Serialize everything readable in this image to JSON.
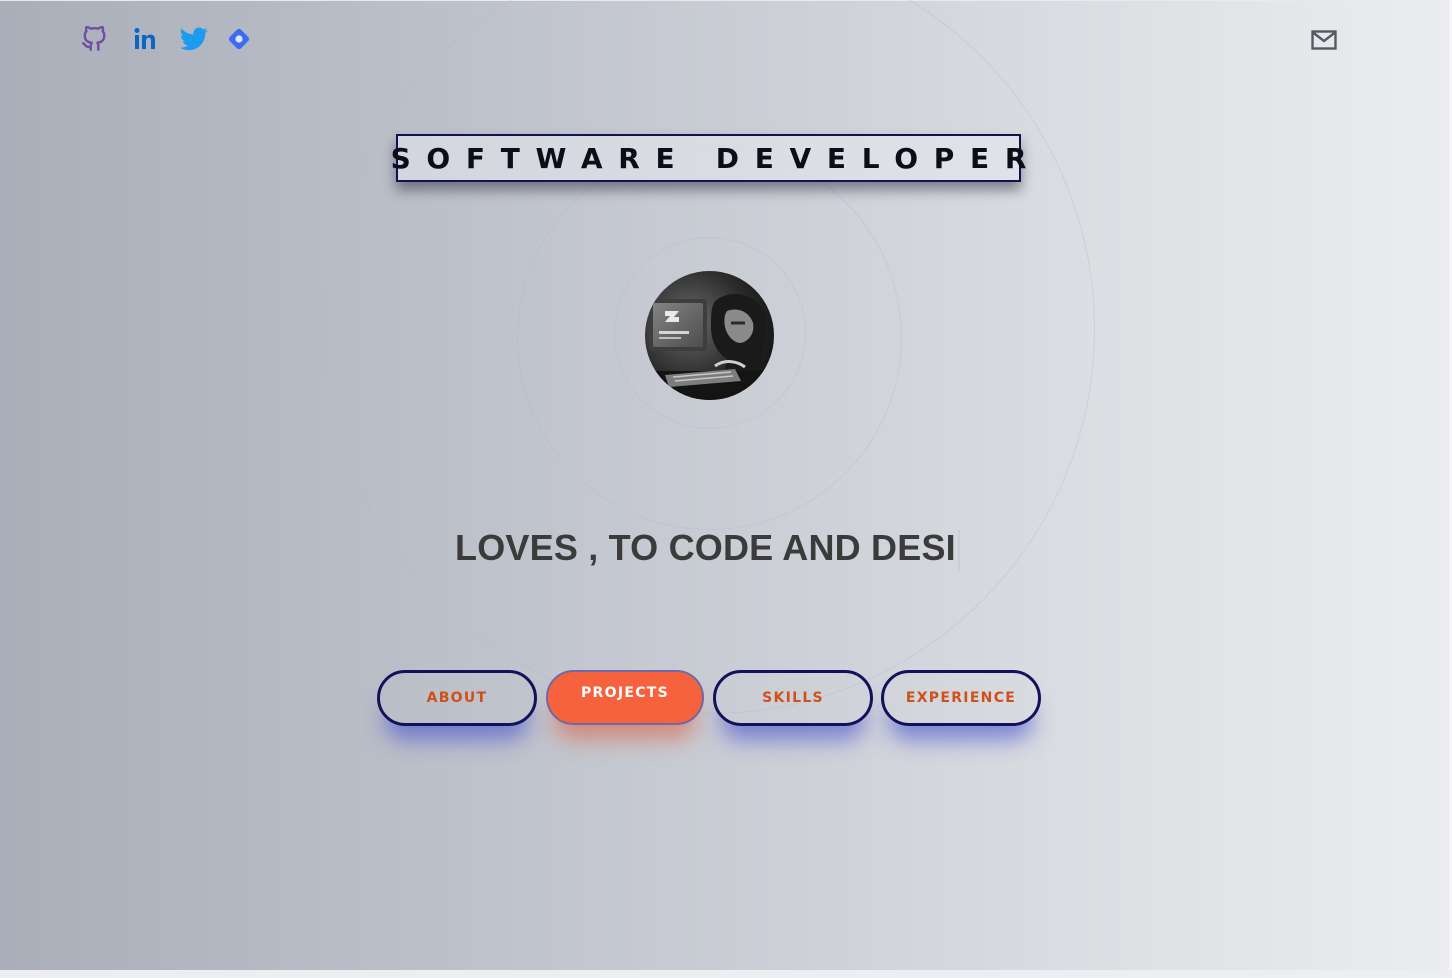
{
  "header": {
    "social_icons": [
      "github-icon",
      "linkedin-icon",
      "twitter-icon",
      "portfolio-icon"
    ],
    "mail_icon": "mail-icon"
  },
  "hero": {
    "title": "SOFTWARE DEVELOPER",
    "tagline": "LOVES , TO CODE AND DESI",
    "avatar": "profile-photo"
  },
  "nav": {
    "buttons": [
      {
        "label": "ABOUT",
        "active": false
      },
      {
        "label": "PROJECTS",
        "active": true
      },
      {
        "label": "SKILLS",
        "active": false
      },
      {
        "label": "EXPERIENCE",
        "active": false
      }
    ]
  },
  "colors": {
    "button_border": "#12125c",
    "button_text": "#d0501a",
    "active_button_bg": "#f6623d",
    "github": "#6e4fa3",
    "linkedin": "#0a66c2",
    "twitter": "#1d9bf0",
    "portfolio": "#3b6cf3"
  }
}
